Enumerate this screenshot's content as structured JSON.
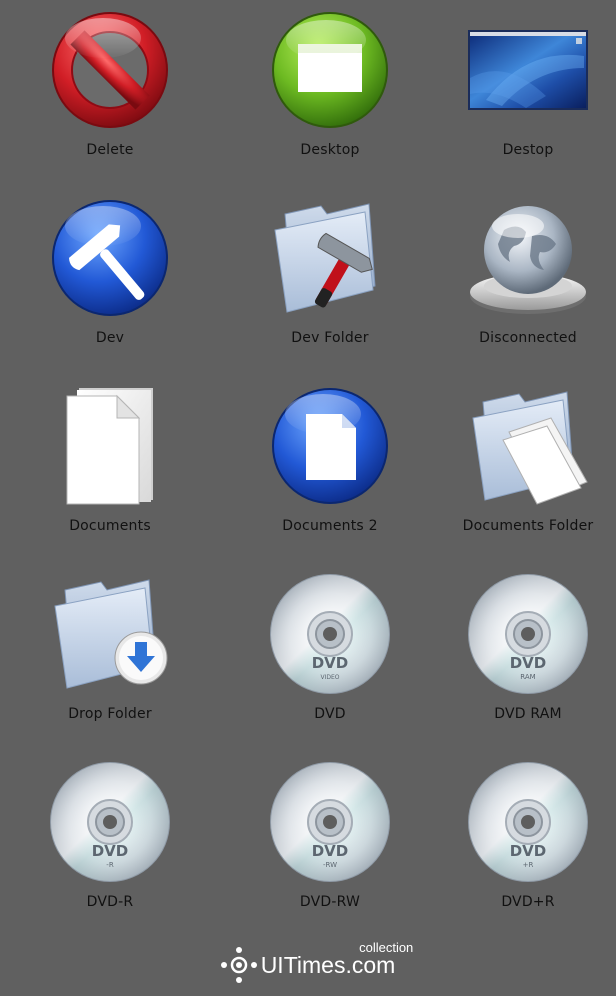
{
  "icons": [
    {
      "label": "Delete",
      "icon": "no-entry-icon"
    },
    {
      "label": "Desktop",
      "icon": "desktop-window-icon"
    },
    {
      "label": "Destop",
      "icon": "desktop-screen-icon"
    },
    {
      "label": "Dev",
      "icon": "hammer-icon"
    },
    {
      "label": "Dev Folder",
      "icon": "folder-hammer-icon"
    },
    {
      "label": "Disconnected",
      "icon": "globe-icon"
    },
    {
      "label": "Documents",
      "icon": "document-stack-icon"
    },
    {
      "label": "Documents 2",
      "icon": "document-circle-icon"
    },
    {
      "label": "Documents Folder",
      "icon": "folder-documents-icon"
    },
    {
      "label": "Drop Folder",
      "icon": "folder-drop-icon"
    },
    {
      "label": "DVD",
      "icon": "dvd-icon"
    },
    {
      "label": "DVD RAM",
      "icon": "dvd-ram-icon"
    },
    {
      "label": "DVD-R",
      "icon": "dvd-r-icon"
    },
    {
      "label": "DVD-RW",
      "icon": "dvd-rw-icon"
    },
    {
      "label": "DVD+R",
      "icon": "dvd-plus-r-icon"
    }
  ],
  "dvd_sublabels": {
    "dvd": "VIDEO",
    "dvd_ram": "RAM",
    "dvd_r": "-R",
    "dvd_rw": "-RW",
    "dvd_plus_r": "+R"
  },
  "dvd_logo_text": "DVD",
  "footer": {
    "brand": "UITimes.com",
    "sub": "collection",
    "logo_icon": "uitimes-logo-icon"
  },
  "colors": {
    "background": "#606060",
    "label": "#111111",
    "red": "#c8202a",
    "green": "#5da620",
    "blue": "#1f56c8"
  }
}
